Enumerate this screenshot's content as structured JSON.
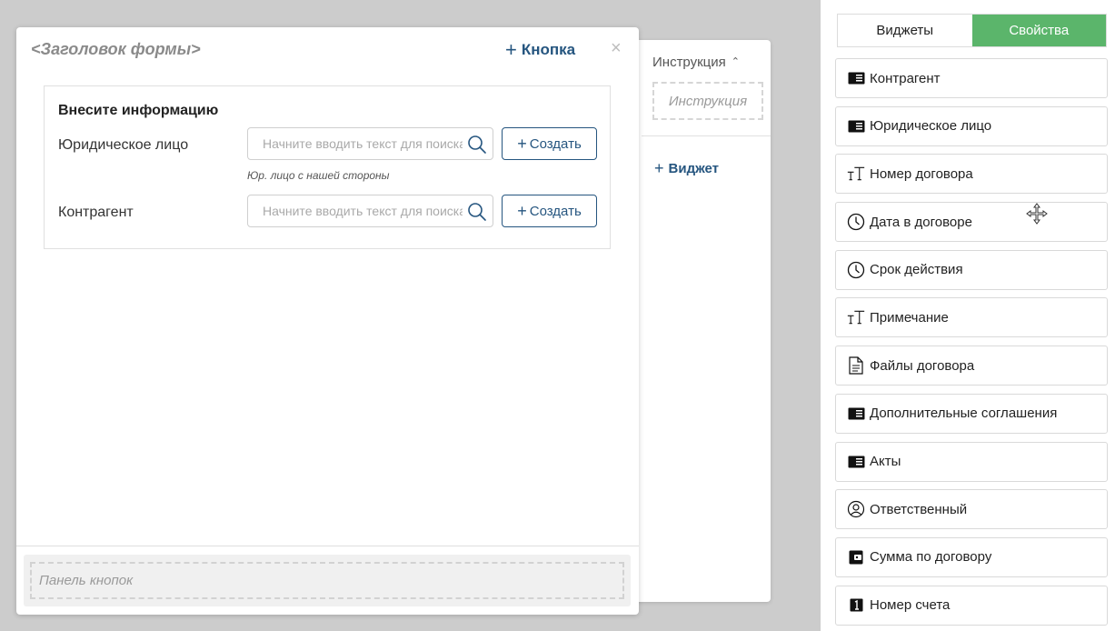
{
  "form": {
    "title": "<Заголовок формы>",
    "add_button_label": "Кнопка",
    "close_symbol": "×",
    "info_block": {
      "title": "Внесите информацию",
      "fields": [
        {
          "label": "Юридическое лицо",
          "placeholder": "Начните вводить текст для поиска",
          "create_label": "Создать",
          "hint": "Юр. лицо с нашей стороны"
        },
        {
          "label": "Контрагент",
          "placeholder": "Начните вводить текст для поиска",
          "create_label": "Создать",
          "hint": ""
        }
      ]
    },
    "button_panel_label": "Панель кнопок"
  },
  "side_panel": {
    "instruction_header": "Инструкция",
    "instruction_placeholder": "Инструкция",
    "add_widget_label": "Виджет"
  },
  "sidebar": {
    "tabs": [
      {
        "label": "Виджеты",
        "active": false
      },
      {
        "label": "Свойства",
        "active": true
      }
    ],
    "items": [
      {
        "label": "Контрагент",
        "icon": "app-card-icon"
      },
      {
        "label": "Юридическое лицо",
        "icon": "app-card-icon"
      },
      {
        "label": "Номер договора",
        "icon": "text-icon"
      },
      {
        "label": "Дата в договоре",
        "icon": "clock-icon"
      },
      {
        "label": "Срок действия",
        "icon": "clock-icon"
      },
      {
        "label": "Примечание",
        "icon": "text-icon"
      },
      {
        "label": "Файлы договора",
        "icon": "file-icon"
      },
      {
        "label": "Дополнительные соглашения",
        "icon": "app-card-icon"
      },
      {
        "label": "Акты",
        "icon": "app-card-icon"
      },
      {
        "label": "Ответственный",
        "icon": "user-icon"
      },
      {
        "label": "Сумма по договору",
        "icon": "wallet-icon"
      },
      {
        "label": "Номер счета",
        "icon": "number-icon"
      }
    ]
  },
  "colors": {
    "accent_blue": "#25557f",
    "active_tab_green": "#5bb56b",
    "backdrop_gray": "#cccccc"
  }
}
